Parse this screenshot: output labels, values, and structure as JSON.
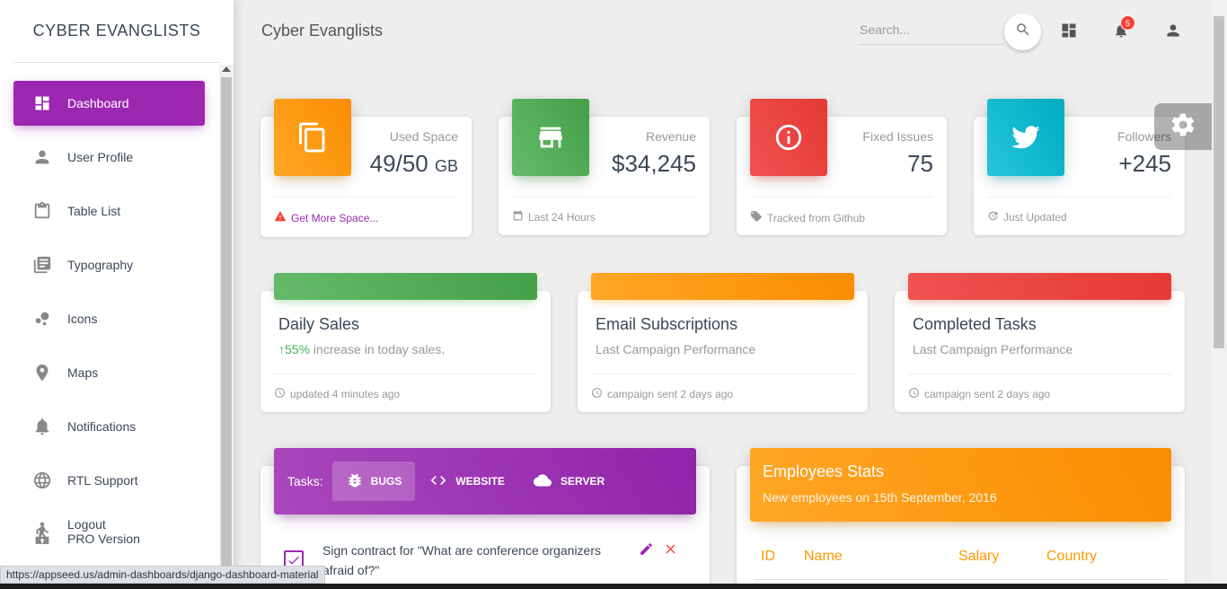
{
  "brand": "CYBER EVANGLISTS",
  "top": {
    "title": "Cyber Evanglists",
    "search_placeholder": "Search...",
    "notification_count": "5"
  },
  "sidebar": {
    "items": [
      {
        "label": "Dashboard",
        "icon": "dashboard-icon"
      },
      {
        "label": "User Profile",
        "icon": "person-icon"
      },
      {
        "label": "Table List",
        "icon": "clipboard-icon"
      },
      {
        "label": "Typography",
        "icon": "library-books-icon"
      },
      {
        "label": "Icons",
        "icon": "bubble-chart-icon"
      },
      {
        "label": "Maps",
        "icon": "location-icon"
      },
      {
        "label": "Notifications",
        "icon": "bell-icon"
      },
      {
        "label": "RTL Support",
        "icon": "globe-icon"
      },
      {
        "label": "Logout",
        "icon": "logout-icon"
      }
    ],
    "pro_label": "PRO Version"
  },
  "stats": [
    {
      "category": "Used Space",
      "value": "49/50",
      "unit": "GB",
      "footer": "Get More Space...",
      "color": "#ff9800"
    },
    {
      "category": "Revenue",
      "value": "$34,245",
      "footer": "Last 24 Hours",
      "color": "#43a047"
    },
    {
      "category": "Fixed Issues",
      "value": "75",
      "footer": "Tracked from Github",
      "color": "#e53935"
    },
    {
      "category": "Followers",
      "value": "+245",
      "footer": "Just Updated",
      "color": "#00acc1"
    }
  ],
  "charts": [
    {
      "title": "Daily Sales",
      "highlight": "55%",
      "subtitle": " increase in today sales.",
      "footer": "updated 4 minutes ago"
    },
    {
      "title": "Email Subscriptions",
      "subtitle": "Last Campaign Performance",
      "footer": "campaign sent 2 days ago"
    },
    {
      "title": "Completed Tasks",
      "subtitle": "Last Campaign Performance",
      "footer": "campaign sent 2 days ago"
    }
  ],
  "tasks": {
    "label": "Tasks:",
    "tabs": [
      "BUGS",
      "WEBSITE",
      "SERVER"
    ],
    "items": [
      {
        "text": "Sign contract for \"What are conference organizers afraid of?\"",
        "checked": true
      }
    ]
  },
  "employees": {
    "title": "Employees Stats",
    "subtitle": "New employees on 15th September, 2016",
    "columns": [
      "ID",
      "Name",
      "Salary",
      "Country"
    ]
  },
  "status_url": "https://appseed.us/admin-dashboards/django-dashboard-material"
}
